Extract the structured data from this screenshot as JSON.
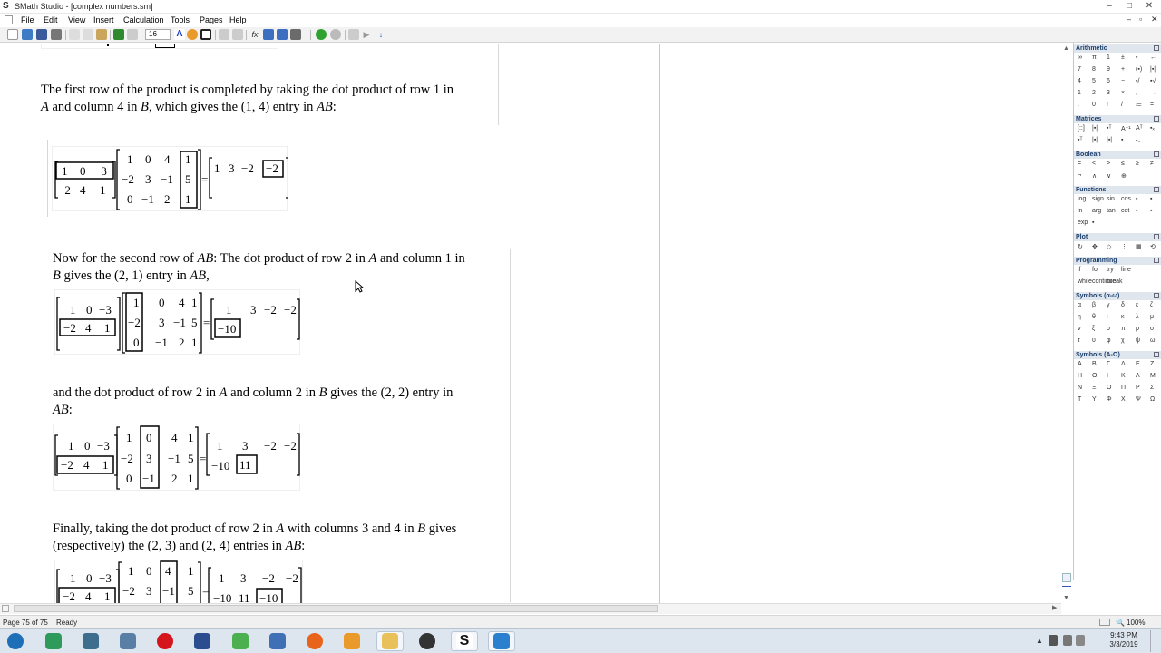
{
  "window": {
    "title": "SMath Studio - [complex numbers.sm]",
    "buttons": [
      "–",
      "□",
      "✕"
    ]
  },
  "menu": {
    "items": [
      "File",
      "Edit",
      "View",
      "Insert",
      "Calculation",
      "Tools",
      "Pages",
      "Help"
    ],
    "mdi": [
      "–",
      "▫",
      "✕"
    ]
  },
  "toolbar": {
    "font_size": "16"
  },
  "sheet": {
    "p1": {
      "pre": "The first row of the product is completed by taking the dot product of row 1 in",
      "line2a": "A",
      "line2b": " and column 4 in ",
      "line2c": "B",
      "line2d": ", which gives the (1, 4) entry in ",
      "line2e": "AB",
      "line2f": ":"
    },
    "p2": {
      "l1a": "Now for the second row of ",
      "l1b": "AB",
      "l1c": ": The dot product of row 2 in ",
      "l1d": "A",
      "l1e": " and column 1 in",
      "l2a": "B",
      "l2b": " gives the (2, 1) entry in ",
      "l2c": "AB",
      "l2d": ","
    },
    "p3": {
      "l1a": "and the dot product of row 2 in ",
      "l1b": "A",
      "l1c": " and column 2 in ",
      "l1d": "B",
      "l1e": " gives the (2, 2) entry in",
      "l2a": "AB",
      "l2b": ":"
    },
    "p4": {
      "l1a": "Finally, taking the dot product of row 2 in ",
      "l1b": "A",
      "l1c": " with columns 3 and 4 in ",
      "l1d": "B",
      "l1e": " gives",
      "l2a": "(respectively) the (2, 3) and (2, 4) entries in ",
      "l2b": "AB",
      "l2c": ":"
    },
    "matrixA": [
      [
        "1",
        "0",
        "-3"
      ],
      [
        "-2",
        "4",
        "1"
      ]
    ],
    "matrixB": [
      [
        "1",
        "0",
        "4",
        "1"
      ],
      [
        "-2",
        "3",
        "-1",
        "5"
      ],
      [
        "0",
        "-1",
        "2",
        "1"
      ]
    ],
    "result1": [
      [
        "1",
        "3",
        "-2",
        "-2"
      ]
    ],
    "result2": [
      [
        "1",
        "3",
        "-2",
        "-2"
      ],
      [
        "-10",
        "",
        "",
        ""
      ]
    ],
    "result3": [
      [
        "1",
        "3",
        "-2",
        "-2"
      ],
      [
        "-10",
        "11",
        "",
        ""
      ]
    ],
    "result4": [
      [
        "1",
        "3",
        "-2",
        "-2"
      ],
      [
        "-10",
        "11",
        "-10",
        ""
      ]
    ]
  },
  "panel": {
    "sections": [
      {
        "title": "Arithmetic",
        "rows": [
          [
            "∞",
            "π",
            "1",
            "±",
            "▪",
            "←"
          ],
          [
            "7",
            "8",
            "9",
            "+",
            "(▪)",
            "|▪|"
          ],
          [
            "4",
            "5",
            "6",
            "−",
            "▪/",
            "▪√"
          ],
          [
            "1",
            "2",
            "3",
            "×",
            ",",
            "→"
          ],
          [
            ".",
            "0",
            "!",
            "/",
            "≔",
            "="
          ]
        ]
      },
      {
        "title": "Matrices",
        "rows": [
          [
            "[::]",
            "|▪|",
            "▪ᵀ",
            "A⁻¹",
            "Aᵀ",
            "▪ₓ"
          ],
          [
            "▪ᵀ",
            "|▪|",
            "|▪|",
            "▪.",
            "▪ₙ",
            ""
          ]
        ]
      },
      {
        "title": "Boolean",
        "rows": [
          [
            "=",
            "<",
            ">",
            "≤",
            "≥",
            "≠"
          ],
          [
            "¬",
            "∧",
            "∨",
            "⊕",
            "",
            ""
          ]
        ]
      },
      {
        "title": "Functions",
        "rows": [
          [
            "log",
            "sign",
            "sin",
            "cos",
            "▪",
            "▪"
          ],
          [
            "ln",
            "arg",
            "tan",
            "cot",
            "▪",
            "▪"
          ],
          [
            "exp",
            "▪",
            "",
            "",
            "",
            ""
          ]
        ]
      },
      {
        "title": "Plot",
        "rows": [
          [
            "↻",
            "✥",
            "◇",
            "⋮",
            "▦",
            "⟲"
          ]
        ]
      },
      {
        "title": "Programming",
        "rows": [
          [
            "if",
            "for",
            "try",
            "line",
            "",
            ""
          ],
          [
            "while",
            "continue",
            "break",
            "",
            "",
            ""
          ]
        ]
      },
      {
        "title": "Symbols (α-ω)",
        "rows": [
          [
            "α",
            "β",
            "γ",
            "δ",
            "ε",
            "ζ"
          ],
          [
            "η",
            "θ",
            "ι",
            "κ",
            "λ",
            "μ"
          ],
          [
            "ν",
            "ξ",
            "ο",
            "π",
            "ρ",
            "σ"
          ],
          [
            "τ",
            "υ",
            "φ",
            "χ",
            "ψ",
            "ω"
          ]
        ]
      },
      {
        "title": "Symbols (A-Ω)",
        "rows": [
          [
            "Α",
            "Β",
            "Γ",
            "Δ",
            "Ε",
            "Ζ"
          ],
          [
            "Η",
            "Θ",
            "Ι",
            "Κ",
            "Λ",
            "Μ"
          ],
          [
            "Ν",
            "Ξ",
            "Ο",
            "Π",
            "Ρ",
            "Σ"
          ],
          [
            "Τ",
            "Υ",
            "Φ",
            "Χ",
            "Ψ",
            "Ω"
          ]
        ]
      }
    ]
  },
  "status": {
    "page": "Page 75 of 75",
    "state": "Ready",
    "zoom": "100%"
  },
  "taskbar": {
    "time": "9:43 PM",
    "date": "3/3/2019"
  },
  "colors": {
    "panel_header": "#dfe6ee",
    "taskbar": "#dde6ef"
  }
}
